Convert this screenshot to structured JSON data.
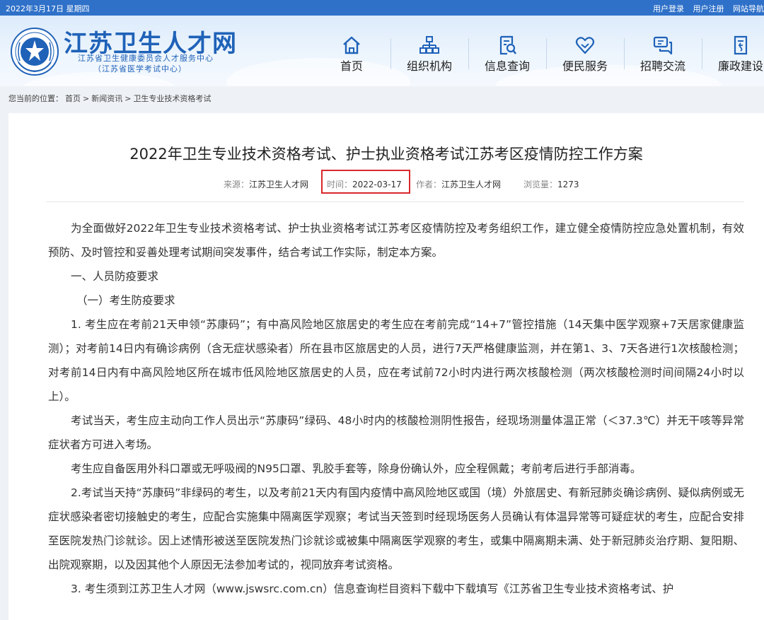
{
  "topbar": {
    "date": "2022年3月17日 星期四",
    "links": [
      "用户登录",
      "用户注册",
      "网站导航"
    ]
  },
  "header": {
    "site_name": "江苏卫生人才网",
    "subtitle_1": "江苏省卫生健康委员会人才服务中心",
    "subtitle_2": "（江苏省医学考试中心）"
  },
  "nav": [
    {
      "label": "首页",
      "icon": "home-icon"
    },
    {
      "label": "组织机构",
      "icon": "org-chart-icon"
    },
    {
      "label": "信息查询",
      "icon": "document-search-icon"
    },
    {
      "label": "便民服务",
      "icon": "heart-service-icon"
    },
    {
      "label": "招聘交流",
      "icon": "chat-icon"
    },
    {
      "label": "廉政建设",
      "icon": "shield-doc-icon"
    }
  ],
  "breadcrumb": {
    "prefix": "您当前的位置：",
    "items": [
      "首页",
      "新闻资讯",
      "卫生专业技术资格考试"
    ],
    "separator": ">"
  },
  "article": {
    "title": "2022年卫生专业技术资格考试、护士执业资格考试江苏考区疫情防控工作方案",
    "source_label": "来源：",
    "source": "江苏卫生人才网",
    "time_label": "时间：",
    "time": "2022-03-17",
    "author_label": "作者：",
    "author": "江苏卫生人才网",
    "views_label": "浏览量：",
    "views": "1273",
    "paragraphs": [
      "为全面做好2022年卫生专业技术资格考试、护士执业资格考试江苏考区疫情防控及考务组织工作，建立健全疫情防控应急处置机制，有效预防、及时管控和妥善处理考试期间突发事件，结合考试工作实际，制定本方案。",
      "一、人员防疫要求",
      "（一）考生防疫要求",
      "1. 考生应在考前21天申领“苏康码”；有中高风险地区旅居史的考生应在考前完成“14+7”管控措施（14天集中医学观察+7天居家健康监测）；对考前14日内有确诊病例（含无症状感染者）所在县市区旅居史的人员，进行7天严格健康监测，并在第1、3、7天各进行1次核酸检测；对考前14日内有中高风险地区所在城市低风险地区旅居史的人员，应在考试前72小时内进行两次核酸检测（两次核酸检测时间间隔24小时以上）。",
      "考试当天，考生应主动向工作人员出示“苏康码”绿码、48小时内的核酸检测阴性报告，经现场测量体温正常（＜37.3℃）并无干咳等异常症状者方可进入考场。",
      "考生应自备医用外科口罩或无呼吸阀的N95口罩、乳胶手套等，除身份确认外，应全程佩戴；考前考后进行手部消毒。",
      "2.考试当天持“苏康码”非绿码的考生，以及考前21天内有国内疫情中高风险地区或国（境）外旅居史、有新冠肺炎确诊病例、疑似病例或无症状感染者密切接触史的考生，应配合实施集中隔离医学观察；考试当天签到时经现场医务人员确认有体温异常等可疑症状的考生，应配合安排至医院发热门诊就诊。因上述情形被送至医院发热门诊就诊或被集中隔离医学观察的考生，或集中隔离期未满、处于新冠肺炎治疗期、复阳期、出院观察期，以及因其他个人原因无法参加考试的，视同放弃考试资格。",
      "3. 考生须到江苏卫生人才网（www.jswsrc.com.cn）信息查询栏目资料下载中下载填写《江苏省卫生专业技术资格考试、护"
    ]
  },
  "colors": {
    "topbar": "#2f71c9",
    "brand_blue": "#1f62b8",
    "highlight_box": "#d9282b"
  }
}
